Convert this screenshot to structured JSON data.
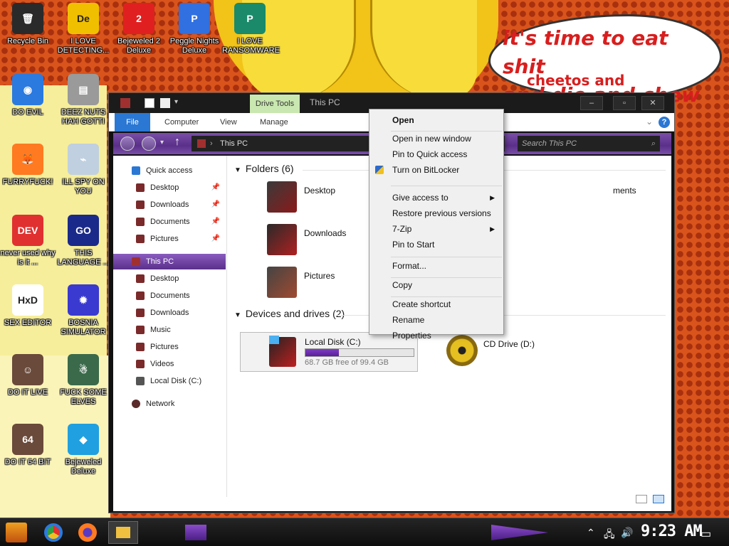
{
  "desktop": {
    "speech_bubble": {
      "line1": "it's time to eat shit",
      "line2": "and die and chew",
      "line3": "cheetos and"
    },
    "icons": [
      {
        "label": "Recycle Bin",
        "icon": "recycle-bin-icon",
        "color": "#2a2a2a",
        "glyph": "🗑"
      },
      {
        "label": "I LOVE DETECTING...",
        "icon": "detect-it-easy-icon",
        "color": "#f0c000",
        "glyph": "De"
      },
      {
        "label": "Bejeweled 2 Deluxe",
        "icon": "bejeweled-2-icon",
        "color": "#e02020",
        "glyph": "2"
      },
      {
        "label": "Peggle Nights Deluxe",
        "icon": "peggle-nights-icon",
        "color": "#3070e0",
        "glyph": "P"
      },
      {
        "label": "I LOVE RANSOMWARE",
        "icon": "publisher-icon",
        "color": "#1a8a6a",
        "glyph": "P"
      },
      {
        "label": "DO EVIL",
        "icon": "chrome-icon",
        "color": "#2a7ae0",
        "glyph": "◉"
      },
      {
        "label": "DEEZ NUTS HAH GOTTI",
        "icon": "files-icon",
        "color": "#9a9a9a",
        "glyph": "▤"
      },
      {
        "label": "FURRYFUCK!",
        "icon": "firefox-icon",
        "color": "#ff7a20",
        "glyph": "🦊"
      },
      {
        "label": "ILL SPY ON YOU",
        "icon": "network-icon",
        "color": "#c0d0e0",
        "glyph": "⌁"
      },
      {
        "label": "never used why is it ...",
        "icon": "dev-cpp-icon",
        "color": "#e03030",
        "glyph": "DEV"
      },
      {
        "label": "THIS LANGUAGE ...",
        "icon": "golang-icon",
        "color": "#1a2a8a",
        "glyph": "GO"
      },
      {
        "label": "SEX EDITOR",
        "icon": "hxd-icon",
        "color": "#ffffff",
        "glyph": "HxD"
      },
      {
        "label": "BOSNIA SIMULATOR",
        "icon": "minesweeper-icon",
        "color": "#3a3ad0",
        "glyph": "✹"
      },
      {
        "label": "DO IT LIVE",
        "icon": "portrait-icon",
        "color": "#6a4a3a",
        "glyph": "☺"
      },
      {
        "label": "FUCK SOME ELVES",
        "icon": "santa-icon",
        "color": "#3a6a4a",
        "glyph": "☃"
      },
      {
        "label": "DO IT 64 BIT",
        "icon": "portrait-64-icon",
        "color": "#6a4a3a",
        "glyph": "64"
      },
      {
        "label": "Bejeweled Deluxe",
        "icon": "bejeweled-icon",
        "color": "#20a0e0",
        "glyph": "◆"
      }
    ]
  },
  "explorer": {
    "title": "This PC",
    "contextual_tab": "Drive Tools",
    "window_buttons": {
      "minimize": "–",
      "maximize": "▫",
      "close": "✕"
    },
    "ribbon_tabs": [
      "File",
      "Computer",
      "View",
      "Manage"
    ],
    "address": "This PC",
    "search_placeholder": "Search This PC",
    "nav": {
      "quick_access": "Quick access",
      "quick_items": [
        "Desktop",
        "Downloads",
        "Documents",
        "Pictures"
      ],
      "this_pc": "This PC",
      "pc_items": [
        "Desktop",
        "Documents",
        "Downloads",
        "Music",
        "Pictures",
        "Videos",
        "Local Disk (C:)"
      ],
      "network": "Network"
    },
    "folders_header": "Folders (6)",
    "folders": [
      "Desktop",
      "Downloads",
      "Pictures"
    ],
    "partial_folder": "ments",
    "devices_header": "Devices and drives (2)",
    "drives": [
      {
        "name": "Local Disk (C:)",
        "free_text": "68.7 GB free of 99.4 GB",
        "used_fraction": 0.31
      },
      {
        "name": "CD Drive (D:)"
      }
    ]
  },
  "context_menu": {
    "items": [
      {
        "label": "Open",
        "bold": true
      },
      {
        "label": "Open in new window"
      },
      {
        "label": "Pin to Quick access"
      },
      {
        "label": "Turn on BitLocker",
        "icon": "shield-icon"
      },
      {
        "label": "Give access to",
        "submenu": true
      },
      {
        "label": "Restore previous versions"
      },
      {
        "label": "7-Zip",
        "submenu": true
      },
      {
        "label": "Pin to Start"
      },
      {
        "label": "Format..."
      },
      {
        "label": "Copy"
      },
      {
        "label": "Create shortcut"
      },
      {
        "label": "Rename"
      },
      {
        "label": "Properties"
      }
    ]
  },
  "taskbar": {
    "clock": "9:23 AM",
    "apps": [
      "start-icon",
      "chrome-icon",
      "firefox-icon",
      "explorer-icon"
    ]
  },
  "colors": {
    "accent_purple": "#6a2fa8",
    "file_tab_blue": "#2a78d4",
    "drive_tools_green": "#c9e7b0"
  }
}
